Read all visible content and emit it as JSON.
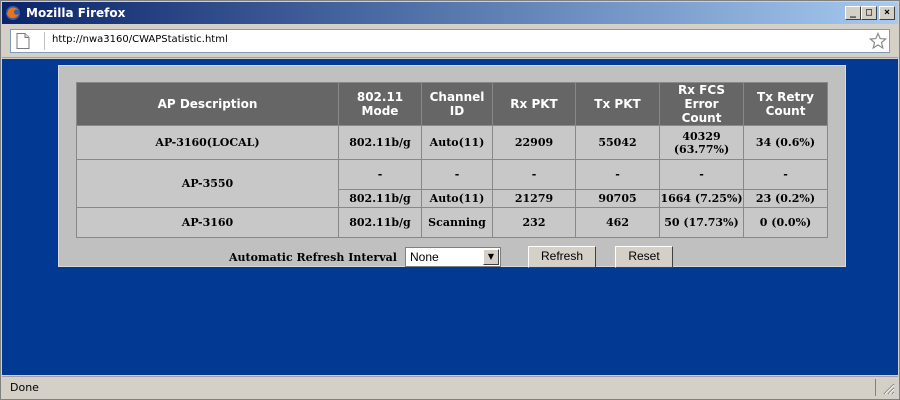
{
  "window": {
    "title": "Mozilla Firefox",
    "icons": {
      "app": "firefox-icon",
      "minimize": "minimize-icon",
      "maximize": "maximize-icon",
      "close": "close-icon"
    }
  },
  "urlbar": {
    "url": "http://nwa3160/CWAPStatistic.html",
    "page_icon": "page-icon",
    "bookmark_icon": "star-icon"
  },
  "table": {
    "headers": {
      "ap_description": "AP Description",
      "mode": "802.11 Mode",
      "channel_line1": "Channel",
      "channel_line2": "ID",
      "rx_pkt": "Rx PKT",
      "tx_pkt": "Tx PKT",
      "rx_fcs_line1": "Rx FCS Error",
      "rx_fcs_line2": "Count",
      "tx_retry_line1": "Tx Retry",
      "tx_retry_line2": "Count"
    },
    "rows": [
      {
        "ap": "AP-3160(LOCAL)",
        "mode": "802.11b/g",
        "channel": "Auto(11)",
        "rx_pkt": "22909",
        "tx_pkt": "55042",
        "rx_fcs_line1": "40329",
        "rx_fcs_line2": "(63.77%)",
        "tx_retry": "34 (0.6%)"
      },
      {
        "ap": "AP-3550",
        "sub1": {
          "mode": "-",
          "channel": "-",
          "rx_pkt": "-",
          "tx_pkt": "-",
          "rx_fcs": "-",
          "tx_retry": "-"
        },
        "sub2": {
          "mode": "802.11b/g",
          "channel": "Auto(11)",
          "rx_pkt": "21279",
          "tx_pkt": "90705",
          "rx_fcs": "1664 (7.25%)",
          "tx_retry": "23 (0.2%)"
        }
      },
      {
        "ap": "AP-3160",
        "mode": "802.11b/g",
        "channel": "Scanning",
        "rx_pkt": "232",
        "tx_pkt": "462",
        "rx_fcs": "50 (17.73%)",
        "tx_retry": "0 (0.0%)"
      }
    ]
  },
  "controls": {
    "refresh_label": "Automatic Refresh Interval",
    "interval_value": "None",
    "refresh_button": "Refresh",
    "reset_button": "Reset"
  },
  "status": {
    "text": "Done"
  },
  "colors": {
    "page_background": "#023a93",
    "header_cell": "#666666",
    "body_cell": "#c8c8c8",
    "panel": "#c0c0c0"
  }
}
